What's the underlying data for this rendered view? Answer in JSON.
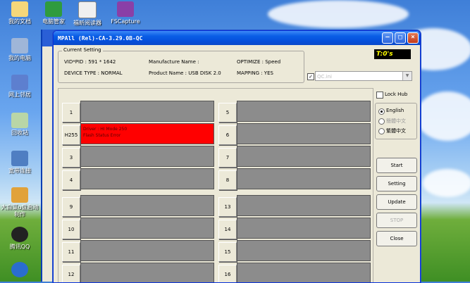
{
  "desktop": {
    "icons": [
      "我的文档",
      "电脑管家",
      "福昕阅读器",
      "FSCapture",
      "我的电脑",
      "网上邻居",
      "回收站",
      "宽带连接",
      "大白菜u盘启动制作",
      "腾讯QQ"
    ],
    "colors": {
      "sky": "#3f7fd8",
      "grass": "#3f8f24"
    }
  },
  "window": {
    "title": "MPAll (Rel)-CA-3.29.0B-QC",
    "controls": [
      "minimize",
      "maximize",
      "close"
    ],
    "current_setting_label": "Current Setting",
    "vid_pid": "VID*PID :  591 * 1642",
    "device_type": "DEVICE TYPE : NORMAL",
    "manufacture": "Manufacture Name :",
    "product": "Product Name : USB DISK 2.0",
    "optimize": "OPTIMIZE : Speed",
    "mapping": "MAPPING : YES",
    "logo": "T:0's",
    "ini_checked": "✓",
    "ini_file": "QC.ini"
  },
  "ports": [
    {
      "btn": "1",
      "text": ""
    },
    {
      "btn": "H255",
      "text": "Driver : HI Mode 250\nFlash Status Error",
      "active": true
    },
    {
      "btn": "3",
      "text": ""
    },
    {
      "btn": "4",
      "text": ""
    },
    {
      "btn": "9",
      "text": ""
    },
    {
      "btn": "10",
      "text": ""
    },
    {
      "btn": "11",
      "text": ""
    },
    {
      "btn": "12",
      "text": ""
    },
    {
      "btn": "5",
      "text": ""
    },
    {
      "btn": "6",
      "text": ""
    },
    {
      "btn": "7",
      "text": ""
    },
    {
      "btn": "8",
      "text": ""
    },
    {
      "btn": "13",
      "text": ""
    },
    {
      "btn": "14",
      "text": ""
    },
    {
      "btn": "15",
      "text": ""
    },
    {
      "btn": "16",
      "text": ""
    }
  ],
  "right_panel": {
    "lock_hub": "Lock Hub",
    "languages": [
      "English",
      "簡體中文",
      "繁體中文"
    ],
    "selected_language": "English",
    "buttons": {
      "start": "Start",
      "setting": "Setting",
      "update": "Update",
      "stop": "STOP",
      "close": "Close"
    }
  }
}
